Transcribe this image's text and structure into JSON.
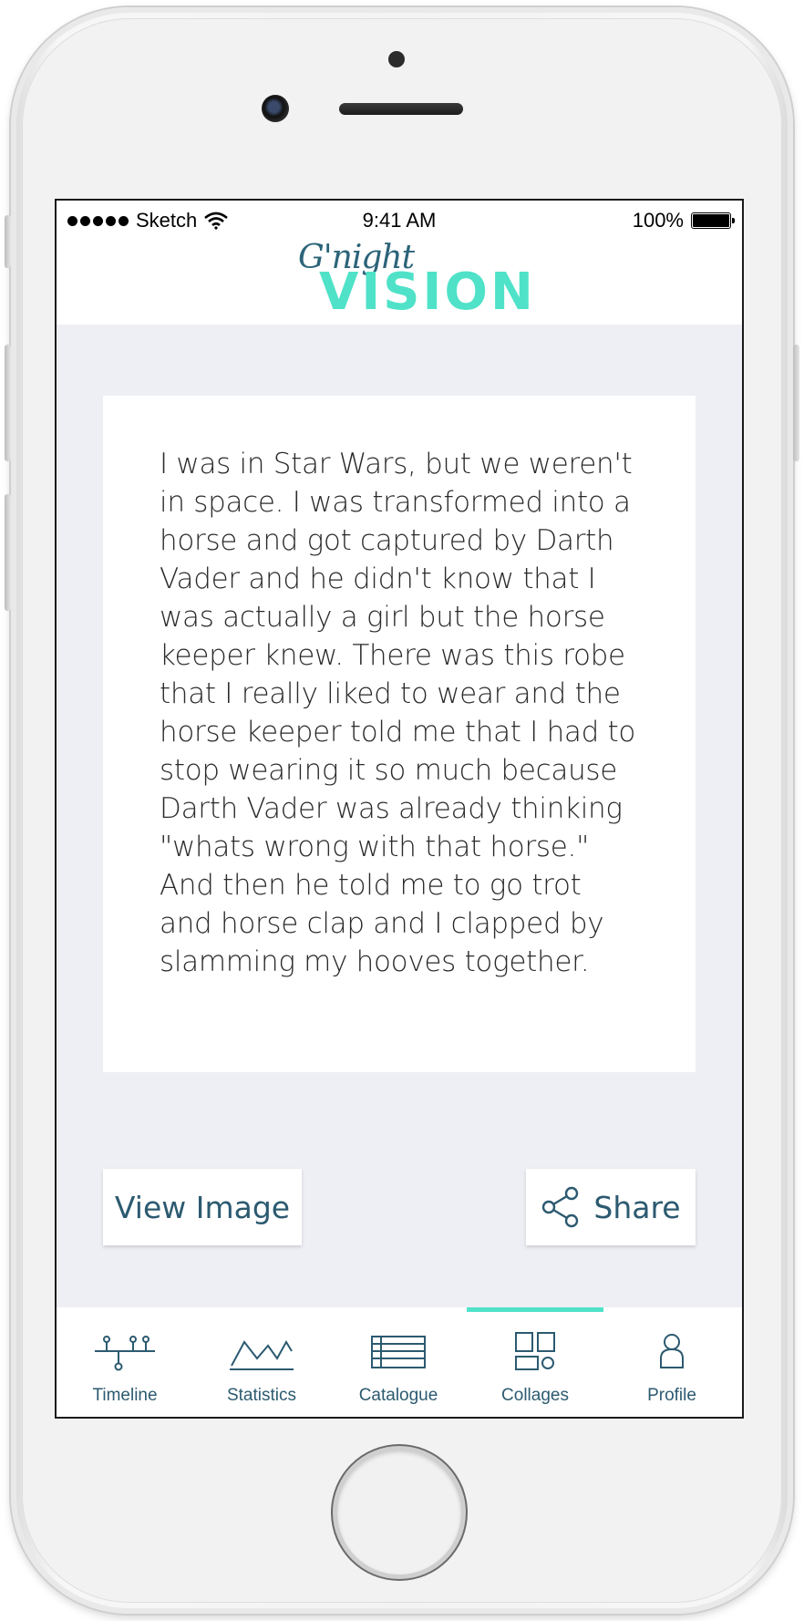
{
  "status_bar": {
    "carrier": "Sketch",
    "time": "9:41 AM",
    "battery": "100%"
  },
  "header": {
    "logo_script": "G'night",
    "logo_main": "VISION"
  },
  "dream": {
    "text": "I was in Star Wars, but we weren't in space. I was transformed into a horse and got captured by Darth Vader and he didn't know that I was actually a girl but the horse keeper knew. There was this robe that I really liked to wear and the horse keeper told me that I had to stop wearing it so much because Darth Vader was already thinking \"whats wrong with that horse.\" And then he told me to go trot and horse clap and I clapped by slamming my hooves together."
  },
  "actions": {
    "view_image": "View Image",
    "share": "Share"
  },
  "tabs": [
    {
      "label": "Timeline",
      "icon": "timeline-icon"
    },
    {
      "label": "Statistics",
      "icon": "statistics-icon"
    },
    {
      "label": "Catalogue",
      "icon": "catalogue-icon"
    },
    {
      "label": "Collages",
      "icon": "collages-icon",
      "active": true
    },
    {
      "label": "Profile",
      "icon": "profile-icon"
    }
  ],
  "colors": {
    "accent": "#4fe2c8",
    "primary_text": "#2c5a70",
    "background": "#eeeff4"
  }
}
